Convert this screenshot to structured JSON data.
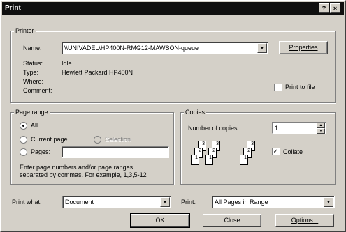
{
  "window": {
    "title": "Print",
    "help_glyph": "?",
    "close_glyph": "×"
  },
  "printer": {
    "group_title": "Printer",
    "name_label": "Name:",
    "name_value": "\\\\UNIVADEL\\HP400N-RMG12-MAWSON-queue",
    "properties_label": "Properties",
    "status_label": "Status:",
    "status_value": "Idle",
    "type_label": "Type:",
    "type_value": "Hewlett Packard HP400N",
    "where_label": "Where:",
    "where_value": "",
    "comment_label": "Comment:",
    "comment_value": "",
    "print_to_file_label": "Print to file",
    "print_to_file_checked": false
  },
  "page_range": {
    "group_title": "Page range",
    "all_label": "All",
    "current_page_label": "Current page",
    "selection_label": "Selection",
    "pages_label": "Pages:",
    "pages_value": "",
    "selected": "all",
    "hint_line1": "Enter page numbers and/or page ranges",
    "hint_line2": "separated by commas.  For example, 1,3,5-12"
  },
  "copies": {
    "group_title": "Copies",
    "number_label": "Number of copies:",
    "number_value": "1",
    "collate_label": "Collate",
    "collate_checked": true,
    "collate_icon": "collate-pages-icon"
  },
  "print_what": {
    "label": "Print what:",
    "value": "Document"
  },
  "print": {
    "label": "Print:",
    "value": "All Pages in Range"
  },
  "buttons": {
    "ok": "OK",
    "close": "Close",
    "options": "Options..."
  }
}
